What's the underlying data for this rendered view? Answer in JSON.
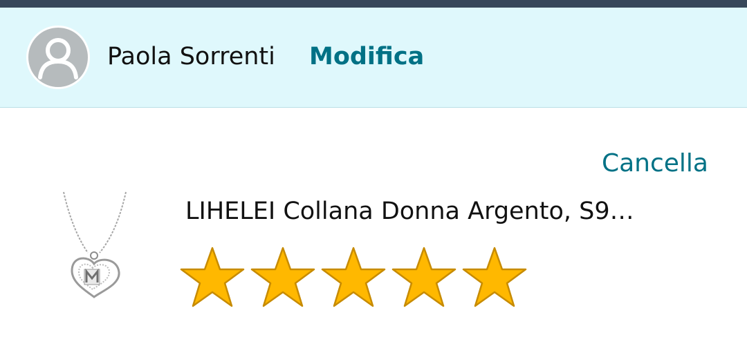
{
  "profile": {
    "name": "Paola Sorrenti",
    "edit_label": "Modifica",
    "avatar_icon": "person-silhouette-icon"
  },
  "review": {
    "delete_label": "Cancella",
    "product_title": "LIHELEI Collana Donna Argento, S9…",
    "product_image_icon": "necklace-heart-pendant-image",
    "rating": {
      "value": 5,
      "max": 5
    }
  },
  "colors": {
    "top_bar": "#37475a",
    "header_bg": "#dff8fc",
    "link": "#007185",
    "star_fill": "#ffb800",
    "star_outline": "#c78b00"
  }
}
